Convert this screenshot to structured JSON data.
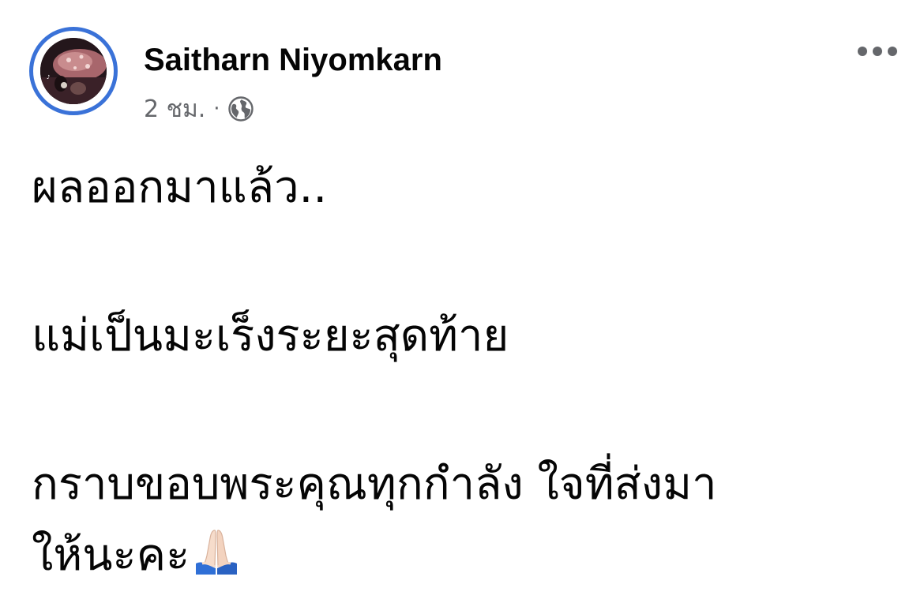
{
  "post": {
    "author": {
      "name": "Saitharn Niyomkarn",
      "avatar_icon": "profile-photo"
    },
    "meta": {
      "time": "2 ชม.",
      "separator": "·",
      "audience_icon": "globe-icon"
    },
    "more_icon": "more-horizontal-icon",
    "text_lines": [
      "ผลออกมาแล้ว..",
      "แม่เป็นมะเร็งระยะสุดท้าย",
      "กราบขอบพระคุณทุกกำลัง ใจที่ส่งมา",
      "ให้นะคะ"
    ],
    "trailing_emoji_icon": "folded-hands-icon"
  },
  "colors": {
    "avatar_ring": "#3a72d8",
    "text": "#050505",
    "meta_text": "#65676b"
  }
}
